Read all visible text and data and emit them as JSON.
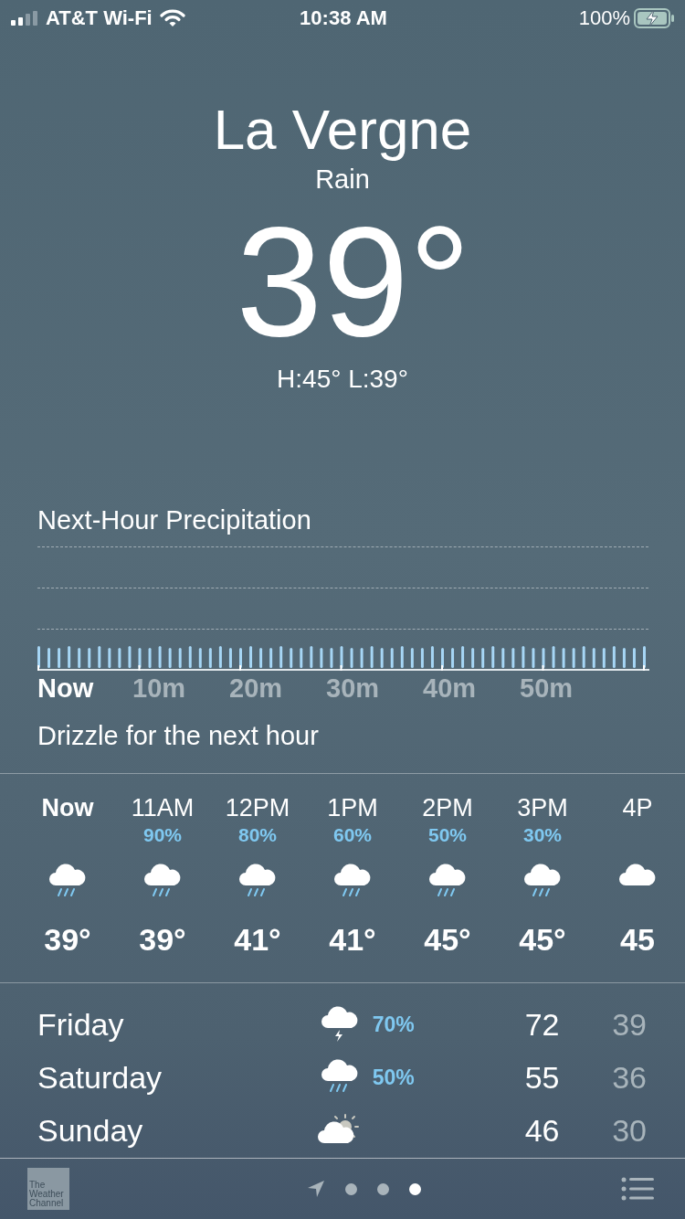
{
  "status_bar": {
    "carrier": "AT&T Wi-Fi",
    "time": "10:38 AM",
    "battery": "100%",
    "charging": true
  },
  "location": {
    "city": "La Vergne",
    "condition": "Rain",
    "temperature": "39°",
    "high_low": "H:45°  L:39°"
  },
  "next_hour": {
    "title": "Next-Hour Precipitation",
    "time_labels": [
      {
        "label": "Now",
        "highlighted": true
      },
      {
        "label": "10m",
        "highlighted": false
      },
      {
        "label": "20m",
        "highlighted": false
      },
      {
        "label": "30m",
        "highlighted": false
      },
      {
        "label": "40m",
        "highlighted": false
      },
      {
        "label": "50m",
        "highlighted": false
      }
    ],
    "summary": "Drizzle for the next hour"
  },
  "hourly": [
    {
      "time": "Now",
      "highlighted": true,
      "kind": "rain",
      "temp": "39°"
    },
    {
      "time": "11AM",
      "chance": "90%",
      "highlighted": false,
      "kind": "rain",
      "temp": "39°"
    },
    {
      "time": "12PM",
      "chance": "80%",
      "highlighted": false,
      "kind": "rain",
      "temp": "41°"
    },
    {
      "time": "1PM",
      "chance": "60%",
      "highlighted": false,
      "kind": "rain",
      "temp": "41°"
    },
    {
      "time": "2PM",
      "chance": "50%",
      "highlighted": false,
      "kind": "rain",
      "temp": "45°"
    },
    {
      "time": "3PM",
      "chance": "30%",
      "highlighted": false,
      "kind": "rain",
      "temp": "45°"
    },
    {
      "time": "4P",
      "highlighted": false,
      "kind": "cloud",
      "temp": "45"
    }
  ],
  "daily": [
    {
      "day": "Friday",
      "kind": "thunderstorm",
      "chance": "70%",
      "high": "72",
      "low": "39"
    },
    {
      "day": "Saturday",
      "kind": "rain",
      "chance": "50%",
      "high": "55",
      "low": "36"
    },
    {
      "day": "Sunday",
      "kind": "partly-sunny",
      "high": "46",
      "low": "30"
    }
  ],
  "bottom_bar": {
    "logo_lines": [
      "The",
      "Weather",
      "Channel"
    ],
    "pages": [
      {
        "kind": "location",
        "selected": false
      },
      {
        "kind": "dot",
        "selected": false
      },
      {
        "kind": "dot",
        "selected": false
      },
      {
        "kind": "dot",
        "selected": true
      }
    ]
  }
}
